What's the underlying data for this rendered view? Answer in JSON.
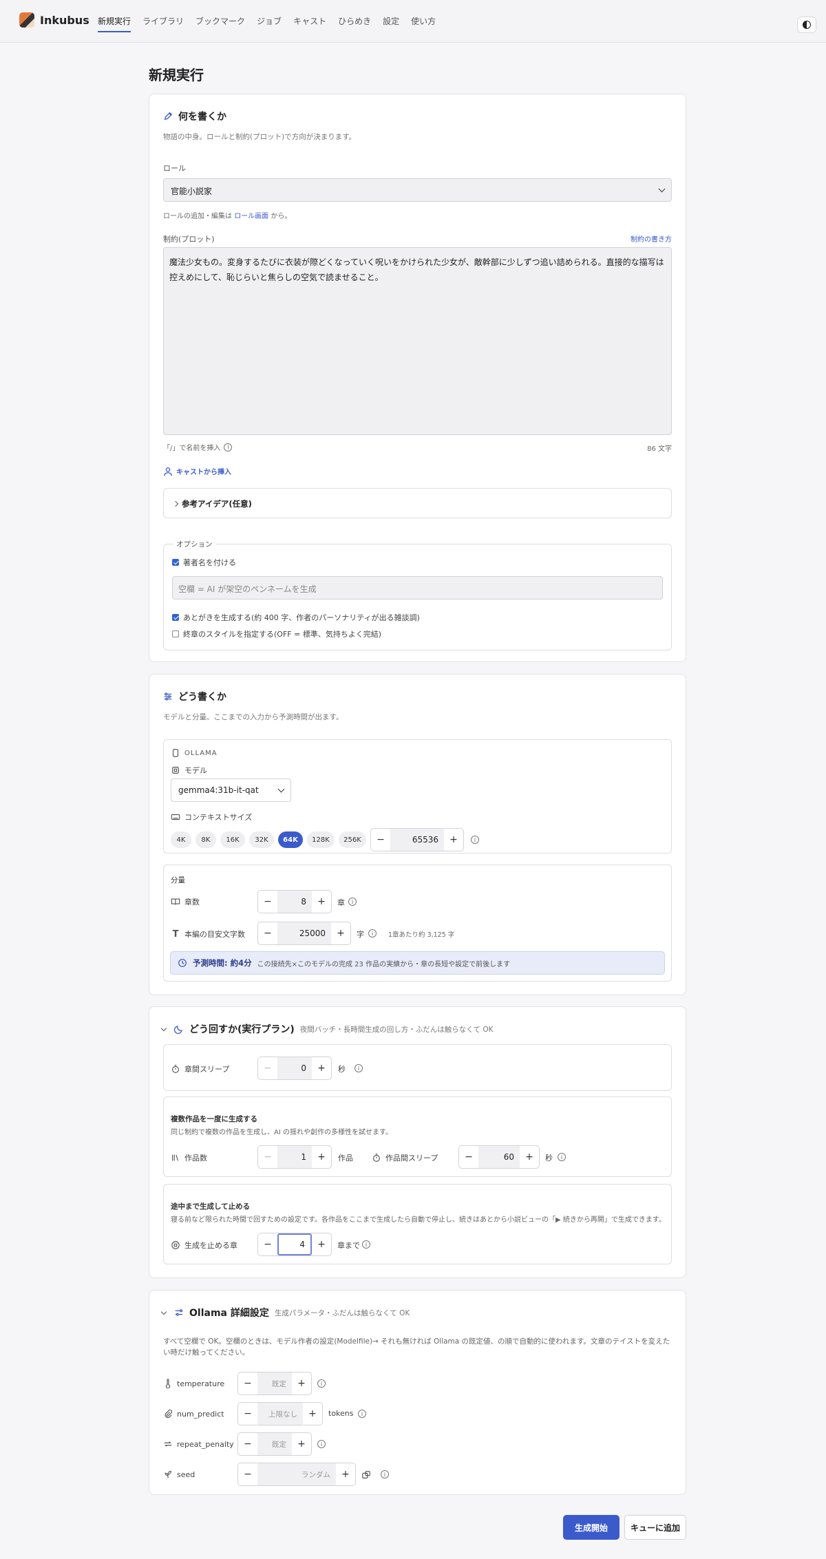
{
  "app": {
    "name": "Inkubus"
  },
  "nav": {
    "items": [
      "新規実行",
      "ライブラリ",
      "ブックマーク",
      "ジョブ",
      "キャスト",
      "ひらめき",
      "設定",
      "使い方"
    ]
  },
  "page": {
    "title": "新規実行"
  },
  "what": {
    "title": "何を書くか",
    "subtitle": "物語の中身。ロールと制約(プロット)で方向が決まります。",
    "role_label": "ロール",
    "role_value": "官能小説家",
    "role_note_prefix": "ロールの追加・編集は",
    "role_note_link": "ロール画面",
    "role_note_suffix": "から。",
    "plot_label": "制約(プロット)",
    "plot_help_link": "制約の書き方",
    "plot_text": "魔法少女もの。変身するたびに衣装が際どくなっていく呪いをかけられた少女が、敵幹部に少しずつ追い詰められる。直接的な描写は控えめにして、恥じらいと焦らしの空気で読ませること。",
    "insert_hint": "「/」で名前を挿入",
    "char_count": "86 文字",
    "cast_insert": "キャストから挿入",
    "reference_title": "参考アイデア(任意)",
    "options_legend": "オプション",
    "opt_author": "著者名を付ける",
    "author_placeholder": "空欄 = AI が架空のペンネームを生成",
    "opt_afterword": "あとがきを生成する(約 400 字、作者のパーソナリティが出る雑談調)",
    "opt_ending": "終章のスタイルを指定する(OFF = 標準、気持ちよく完結)"
  },
  "how": {
    "title": "どう書くか",
    "subtitle": "モデルと分量。ここまでの入力から予測時間が出ます。",
    "provider": "OLLAMA",
    "model_label": "モデル",
    "model_value": "gemma4:31b-it-qat",
    "context_label": "コンテキストサイズ",
    "context_presets": [
      "4K",
      "8K",
      "16K",
      "32K",
      "64K",
      "128K",
      "256K"
    ],
    "context_active": "64K",
    "context_value": "65536",
    "volume_title": "分量",
    "chapters_label": "章数",
    "chapters_value": "8",
    "chapters_unit": "章",
    "length_label": "本編の目安文字数",
    "length_value": "25000",
    "length_unit": "字",
    "length_note": "1章あたり約 3,125 字",
    "estimate_main": "予測時間: 約4分",
    "estimate_note": "この接続先×このモデルの完成 23 作品の実績から・章の長短や設定で前後します"
  },
  "run": {
    "title": "どう回すか(実行プラン)",
    "subtitle": "夜間バッチ・長時間生成の回し方・ふだんは触らなくて OK",
    "sleep_label": "章間スリープ",
    "sleep_value": "0",
    "sleep_unit": "秒",
    "multi_title": "複数作品を一度に生成する",
    "multi_desc": "同じ制約で複数の作品を生成し、AI の揺れや創作の多様性を試せます。",
    "works_label": "作品数",
    "works_value": "1",
    "works_unit": "作品",
    "work_sleep_label": "作品間スリープ",
    "work_sleep_value": "60",
    "work_sleep_unit": "秒",
    "stop_title": "途中まで生成して止める",
    "stop_desc": "寝る前など限られた時間で回すための設定です。各作品をここまで生成したら自動で停止し、続きはあとから小説ビューの「▶ 続きから再開」で生成できます。",
    "stop_label": "生成を止める章",
    "stop_value": "4",
    "stop_unit": "章まで"
  },
  "ollama": {
    "title": "Ollama 詳細設定",
    "subtitle": "生成パラメータ・ふだんは触らなくて OK",
    "desc": "すべて空欄で OK。空欄のときは、モデル作者の設定(Modelfile)→ それも無ければ Ollama の既定値、の順で自動的に使われます。文章のテイストを変えたい時だけ触ってください。",
    "params": [
      {
        "name": "temperature",
        "placeholder": "既定",
        "unit": ""
      },
      {
        "name": "num_predict",
        "placeholder": "上限なし",
        "unit": "tokens"
      },
      {
        "name": "repeat_penalty",
        "placeholder": "既定",
        "unit": ""
      },
      {
        "name": "seed",
        "placeholder": "ランダム",
        "unit": ""
      }
    ]
  },
  "actions": {
    "start": "生成開始",
    "queue": "キューに追加"
  },
  "colors": {
    "accent": "#3b5bcc",
    "background": "#f6f6f8"
  }
}
